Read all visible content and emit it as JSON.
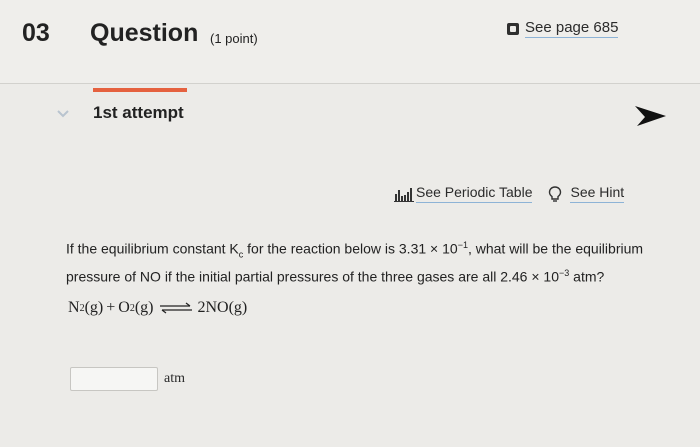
{
  "question": {
    "number": "03",
    "title": "Question",
    "points": "(1 point)"
  },
  "see_page": {
    "label": "See page 685",
    "icon": "book-icon"
  },
  "attempt": {
    "label": "1st attempt",
    "expanded": true
  },
  "tools": {
    "periodic_table": {
      "label": "See Periodic Table",
      "icon": "periodic-table-icon"
    },
    "hint": {
      "label": "See Hint",
      "icon": "lightbulb-icon"
    }
  },
  "prompt": {
    "part1": "If the equilibrium constant K",
    "k_sub": "c",
    "part2": " for the reaction below is 3.31 × 10",
    "exp1": "−1",
    "part3": ", what will be the equilibrium pressure of NO if the initial partial pressures of the three gases are all 2.46 × 10",
    "exp2": "−3",
    "part4": " atm?"
  },
  "equation": {
    "r1": "N",
    "r1_sub": "2",
    "r1_state": "(g)",
    "plus": "+",
    "r2": "O",
    "r2_sub": "2",
    "r2_state": "(g)",
    "product": "2NO",
    "product_state": "(g)"
  },
  "answer": {
    "value": "",
    "unit": "atm"
  },
  "colors": {
    "accent": "#e5613f",
    "link_underline": "#8db3d6"
  }
}
